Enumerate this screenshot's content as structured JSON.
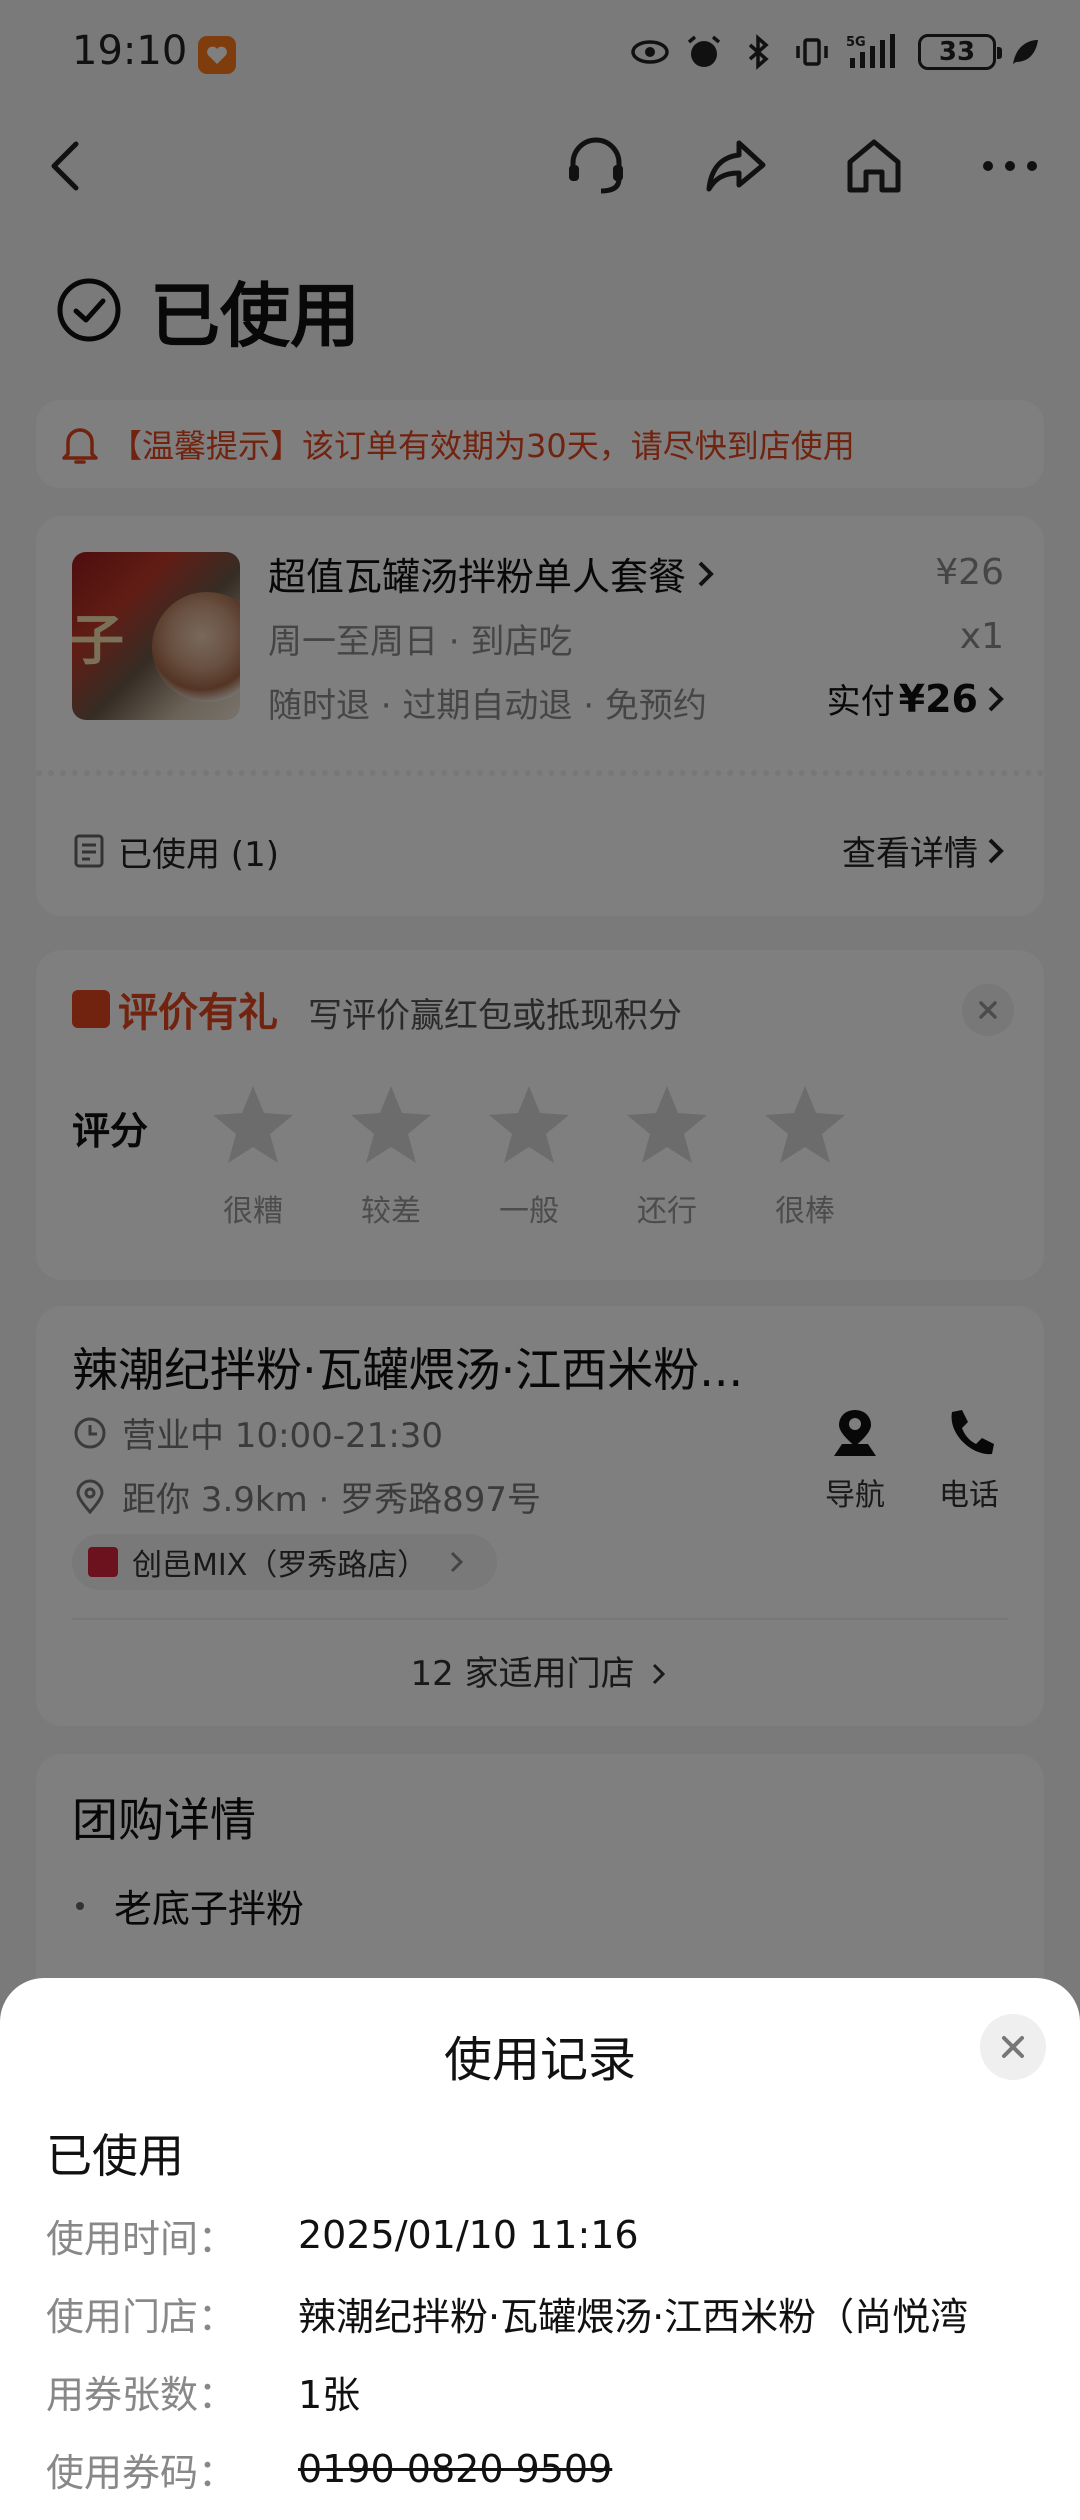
{
  "status_bar": {
    "time": "19:10",
    "battery": "33"
  },
  "page": {
    "title": "已使用"
  },
  "tip": {
    "text": "【温馨提示】该订单有效期为30天，请尽快到店使用"
  },
  "product": {
    "image_text": "子",
    "name": "超值瓦罐汤拌粉单人套餐",
    "sub1": "周一至周日 · 到店吃",
    "sub2": "随时退 · 过期自动退 · 免预约",
    "price": "¥26",
    "qty": "x1",
    "paid_label": "实付",
    "paid_amount": "¥26",
    "used_label": "已使用 (1)",
    "detail_link": "查看详情"
  },
  "review": {
    "title": "评价有礼",
    "subtitle": "写评价赢红包或抵现积分",
    "score_label": "评分",
    "stars": [
      "很糟",
      "较差",
      "一般",
      "还行",
      "很棒"
    ]
  },
  "shop": {
    "name": "辣潮纪拌粉·瓦罐煨汤·江西米粉...",
    "hours": "营业中 10:00-21:30",
    "distance": "距你 3.9km · 罗秀路897号",
    "nav_label": "导航",
    "phone_label": "电话",
    "mall": "创邑MIX（罗秀路店）",
    "store_count": "12 家适用门店"
  },
  "group_buy": {
    "title": "团购详情",
    "items": [
      "老底子拌粉"
    ]
  },
  "sheet": {
    "title": "使用记录",
    "status": "已使用",
    "rows": [
      {
        "label": "使用时间：",
        "value": "2025/01/10 11:16"
      },
      {
        "label": "使用门店：",
        "value": "辣潮纪拌粉·瓦罐煨汤·江西米粉（尚悦湾"
      },
      {
        "label": "用券张数：",
        "value": "1张"
      },
      {
        "label": "使用券码：",
        "value": "0190 0820 9509"
      }
    ]
  },
  "colors": {
    "accent": "#e2461f",
    "overlay": "rgba(0,0,0,0.5)"
  }
}
